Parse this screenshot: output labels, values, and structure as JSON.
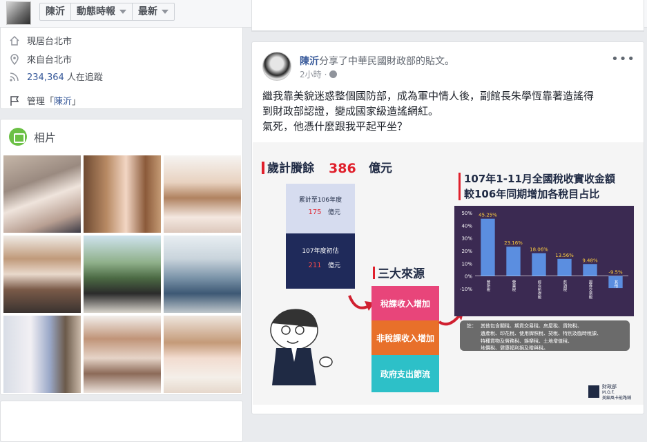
{
  "topbar": {
    "name_tab": "陳沂",
    "tab_active": "動態時報",
    "tab_sort": "最新"
  },
  "about": {
    "lives_in": "現居台北市",
    "from": "來自台北市",
    "followers_count": "234,364",
    "followers_suffix": " 人在追蹤",
    "manage_prefix": "管理「",
    "manage_name": "陳沂",
    "manage_suffix": "」"
  },
  "photos": {
    "title": "相片"
  },
  "post": {
    "author": "陳沂",
    "action": "分享了中華民國財政部的貼文。",
    "time": "2小時",
    "text_line1": "繼我靠美貌迷惑整個國防部，成為軍中情人後，副館長朱學恆靠著造謠得",
    "text_line2": "到財政部認證，變成國家級造謠網紅。",
    "text_line3": "氣死，他憑什麼跟我平起平坐？",
    "more": "•••"
  },
  "infographic": {
    "surplus_prefix": "歲計賸餘",
    "surplus_value": "386",
    "surplus_unit": "億元",
    "box1_label": "累計至106年度",
    "box1_value": "175",
    "box1_unit": "億元",
    "box2_label": "107年度初估",
    "box2_value": "211",
    "box2_unit": "億元",
    "sources_title": "三大來源",
    "source1": "稅課收入增加",
    "source2": "非稅課收入增加",
    "source3": "政府支出節流",
    "chart_title_line1": "107年1-11月全國稅收實收金額",
    "chart_title_line2": "較106年同期增加各稅目占比",
    "note_label": "註：",
    "note_text1": "其他包含關稅、期貨交易稅、房屋稅、貨物稅、",
    "note_text2": "遺產稅、印花稅、使用牌照稅、契稅、特別及臨時稅課、",
    "note_text3": "特種貨物及勞務稅、娛樂稅、土地增值稅、",
    "note_text4": "地價稅、健康福利捐及贈與稅。",
    "ministry": "財政部",
    "ministry_sub": "M.O.F.",
    "ministry_sub2": "美編風卡能路鋪"
  },
  "chart_data": {
    "type": "bar",
    "title": "107年1-11月全國稅收實收金額 較106年同期增加各稅目占比",
    "categories": [
      "營所稅",
      "營業稅",
      "綜合所得稅",
      "菸酒稅",
      "證券交易稅",
      "其他"
    ],
    "values": [
      45.25,
      23.16,
      18.06,
      13.56,
      9.48,
      -9.5
    ],
    "value_labels": [
      "45.25%",
      "23.16%",
      "18.06%",
      "13.56%",
      "9.48%",
      "-9.5%"
    ],
    "ytick_labels": [
      "50%",
      "40%",
      "30%",
      "20%",
      "10%",
      "0%",
      "-10%"
    ],
    "ylim": [
      -10,
      50
    ],
    "grid": false,
    "colors": {
      "bar": "#5b8ee0",
      "background": "#3b2a52"
    }
  },
  "colors": {
    "link": "#365899",
    "accent_red": "#e0202c",
    "pink": "#e8457a",
    "orange": "#e8702a",
    "teal": "#2dc0c8"
  }
}
